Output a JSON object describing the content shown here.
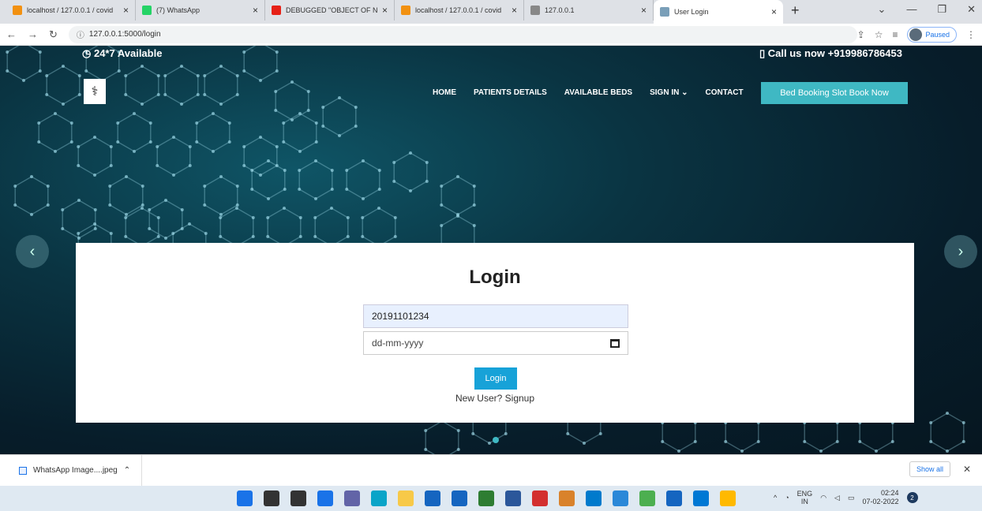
{
  "browser": {
    "tabs": [
      {
        "title": "localhost / 127.0.0.1 / covid",
        "fav": "#f29111"
      },
      {
        "title": "(7) WhatsApp",
        "fav": "#25d366"
      },
      {
        "title": "DEBUGGED \"OBJECT OF No",
        "fav": "#e62117"
      },
      {
        "title": "localhost / 127.0.0.1 / covid",
        "fav": "#f29111"
      },
      {
        "title": "127.0.0.1",
        "fav": "#888888"
      },
      {
        "title": "User Login",
        "fav": "#7a9fb8"
      }
    ],
    "url": "127.0.0.1:5000/login",
    "profile_status": "Paused"
  },
  "site": {
    "availability": "24*7 Available",
    "call": "Call us now +919986786453",
    "nav": [
      "HOME",
      "PATIENTS DETAILS",
      "AVAILABLE BEDS",
      "SIGN IN",
      "CONTACT"
    ],
    "cta": "Bed Booking Slot Book Now"
  },
  "login": {
    "title": "Login",
    "id_value": "20191101234",
    "date_placeholder": "dd-mm-yyyy",
    "button": "Login",
    "signup": "New User? Signup"
  },
  "downloads": {
    "file": "WhatsApp Image....jpeg",
    "show_all": "Show all"
  },
  "taskbar": {
    "lang": "ENG",
    "lang2": "IN",
    "time": "02:24",
    "date": "07-02-2022",
    "badge": "2",
    "icon_colors": [
      "#1a73e8",
      "#333333",
      "#333333",
      "#1a73e8",
      "#6264a7",
      "#0aa4c8",
      "#f7c948",
      "#1565c0",
      "#1565c0",
      "#2e7d32",
      "#2b579a",
      "#d32f2f",
      "#d9822b",
      "#007acc",
      "#2b88d8",
      "#4caf50",
      "#1565c0",
      "#0078d4",
      "#ffb900"
    ]
  },
  "colors": {
    "accent": "#3fb8c3",
    "button": "#17a2d8"
  }
}
